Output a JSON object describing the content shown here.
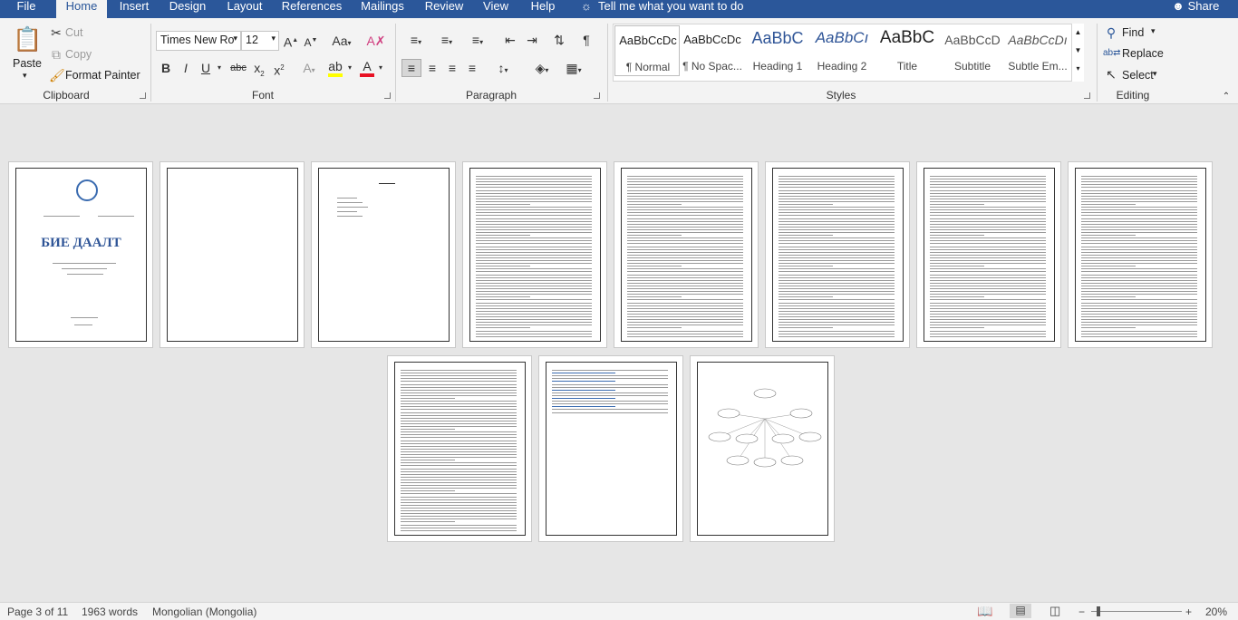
{
  "tabs": {
    "file": "File",
    "home": "Home",
    "insert": "Insert",
    "design": "Design",
    "layout": "Layout",
    "references": "References",
    "mailings": "Mailings",
    "review": "Review",
    "view": "View",
    "help": "Help",
    "tell": "Tell me what you want to do",
    "share": "Share"
  },
  "clipboard": {
    "paste": "Paste",
    "cut": "Cut",
    "copy": "Copy",
    "format_painter": "Format Painter",
    "label": "Clipboard"
  },
  "font": {
    "name": "Times New Ro",
    "size": "12",
    "label": "Font"
  },
  "paragraph": {
    "label": "Paragraph"
  },
  "styles": {
    "label": "Styles",
    "items": [
      {
        "preview": "AaBbCcDc",
        "name": "¶ Normal"
      },
      {
        "preview": "AaBbCcDc",
        "name": "¶ No Spac..."
      },
      {
        "preview": "AaBbC",
        "name": "Heading 1"
      },
      {
        "preview": "AaBbCı",
        "name": "Heading 2"
      },
      {
        "preview": "AaBbC",
        "name": "Title"
      },
      {
        "preview": "AaBbCcD",
        "name": "Subtitle"
      },
      {
        "preview": "AaBbCcDı",
        "name": "Subtle Em..."
      }
    ]
  },
  "editing": {
    "find": "Find",
    "replace": "Replace",
    "select": "Select",
    "label": "Editing"
  },
  "document": {
    "title_text": "БИЕ ДААЛТ"
  },
  "status": {
    "page": "Page 3 of 11",
    "words": "1963 words",
    "language": "Mongolian (Mongolia)",
    "zoom": "20%"
  },
  "colors": {
    "accent": "#2b579a",
    "font_color": "#e81123",
    "highlight": "#ffff00"
  }
}
